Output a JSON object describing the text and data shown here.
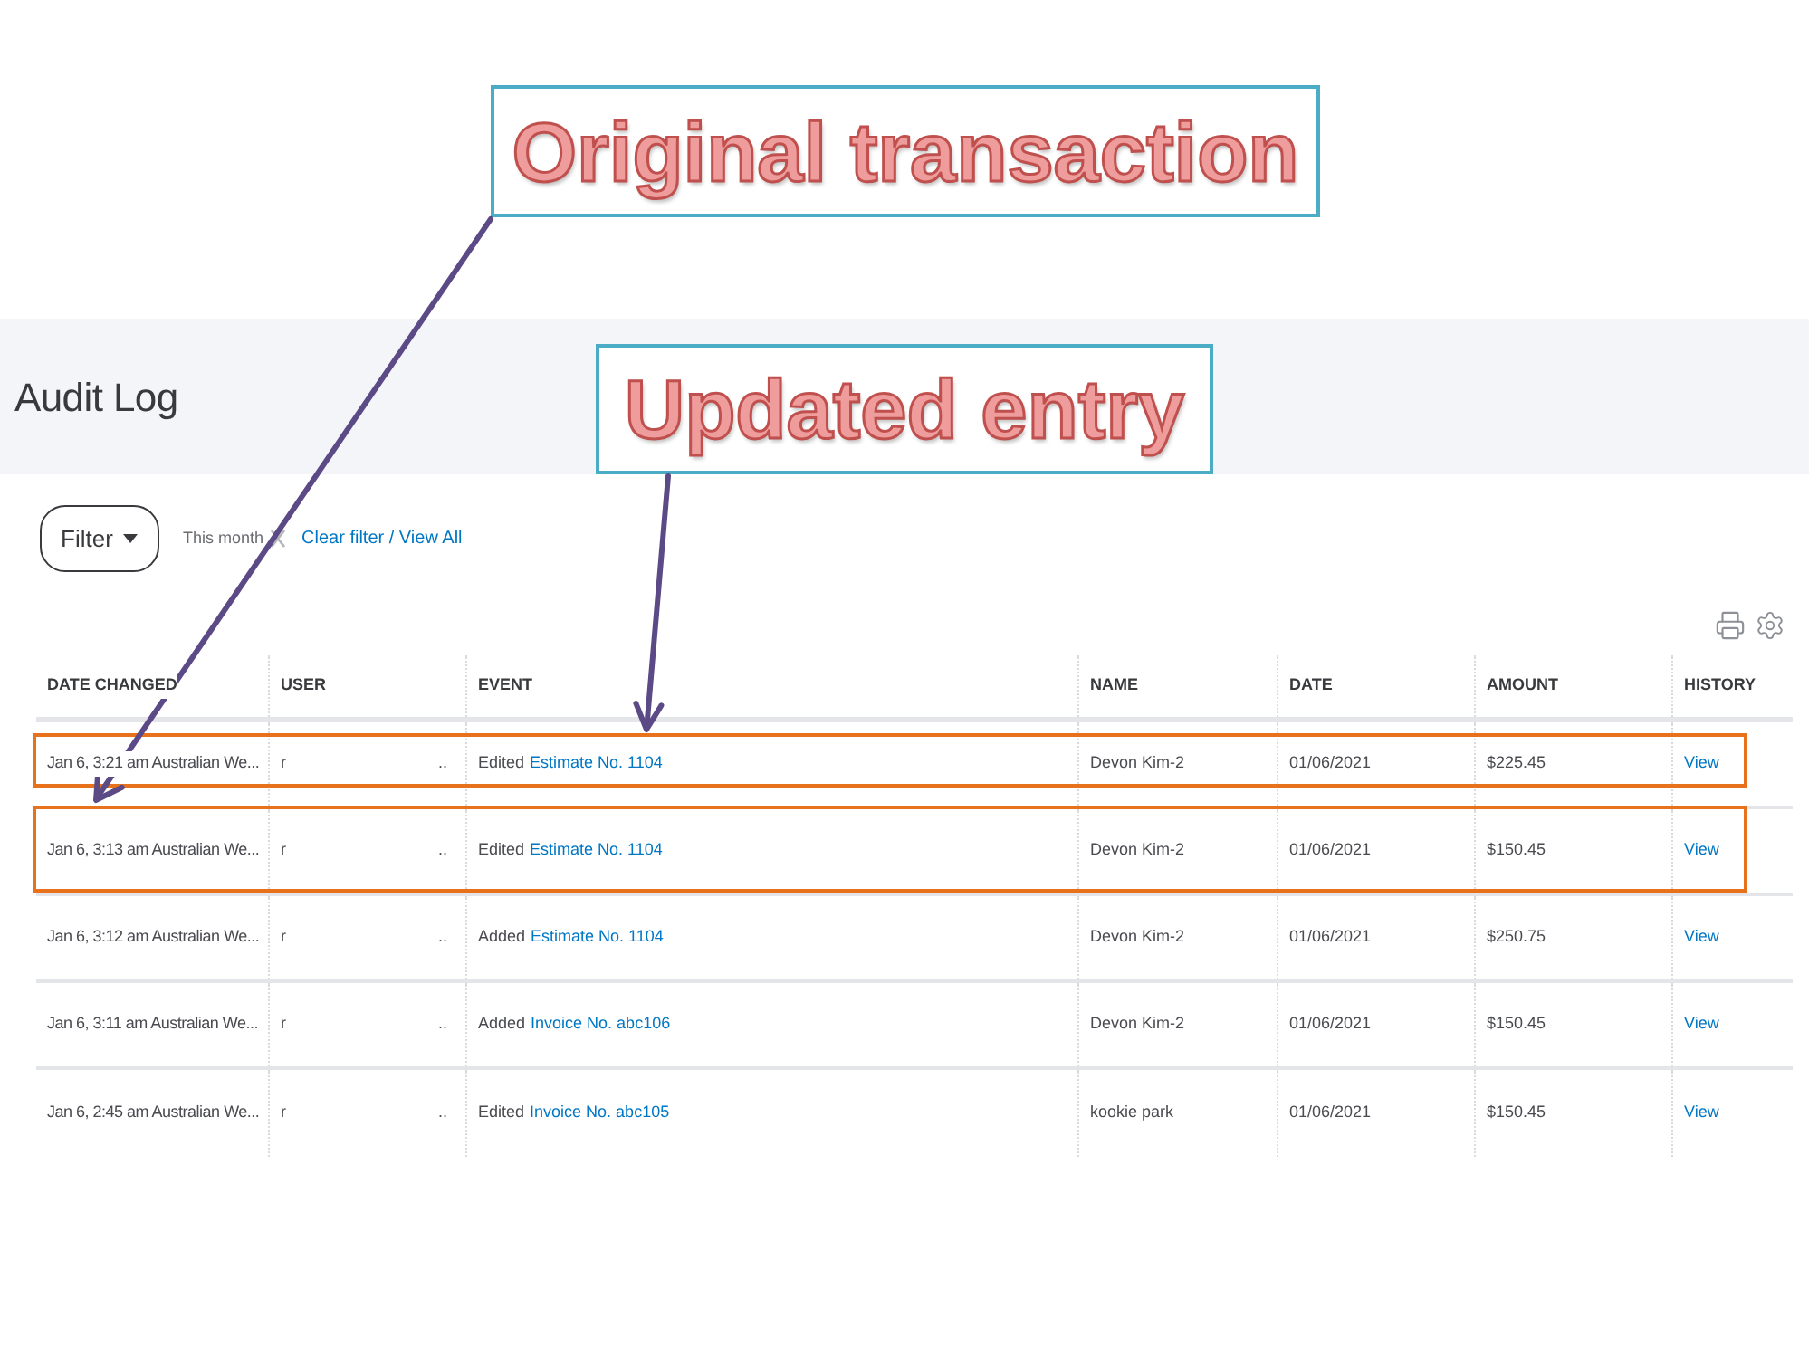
{
  "annotations": [
    {
      "text": "Original transaction"
    },
    {
      "text": "Updated entry"
    }
  ],
  "page": {
    "title": "Audit Log"
  },
  "filter": {
    "button": "Filter",
    "active_filter": "This month",
    "clear_link": "Clear filter / View All"
  },
  "table": {
    "columns": [
      "DATE CHANGED",
      "USER",
      "EVENT",
      "NAME",
      "DATE",
      "AMOUNT",
      "HISTORY"
    ],
    "rows": [
      {
        "date_changed": "Jan 6, 3:21 am Australian We...",
        "user": "r",
        "user_overflow": "..",
        "event_action": "Edited",
        "event_link": "Estimate No. 1104",
        "name": "Devon Kim-2",
        "date": "01/06/2021",
        "amount": "$225.45",
        "history": "View",
        "highlighted": true
      },
      {
        "date_changed": "Jan 6, 3:13 am Australian We...",
        "user": "r",
        "user_overflow": "..",
        "event_action": "Edited",
        "event_link": "Estimate No. 1104",
        "name": "Devon Kim-2",
        "date": "01/06/2021",
        "amount": "$150.45",
        "history": "View",
        "highlighted": true
      },
      {
        "date_changed": "Jan 6, 3:12 am Australian We...",
        "user": "r",
        "user_overflow": "..",
        "event_action": "Added",
        "event_link": "Estimate No. 1104",
        "name": "Devon Kim-2",
        "date": "01/06/2021",
        "amount": "$250.75",
        "history": "View",
        "highlighted": false
      },
      {
        "date_changed": "Jan 6, 3:11 am Australian We...",
        "user": "r",
        "user_overflow": "..",
        "event_action": "Added",
        "event_link": "Invoice No. abc106",
        "name": "Devon Kim-2",
        "date": "01/06/2021",
        "amount": "$150.45",
        "history": "View",
        "highlighted": false
      },
      {
        "date_changed": "Jan 6, 2:45 am Australian We...",
        "user": "r",
        "user_overflow": "..",
        "event_action": "Edited",
        "event_link": "Invoice No. abc105",
        "name": "kookie park",
        "date": "01/06/2021",
        "amount": "$150.45",
        "history": "View",
        "highlighted": false
      }
    ]
  }
}
